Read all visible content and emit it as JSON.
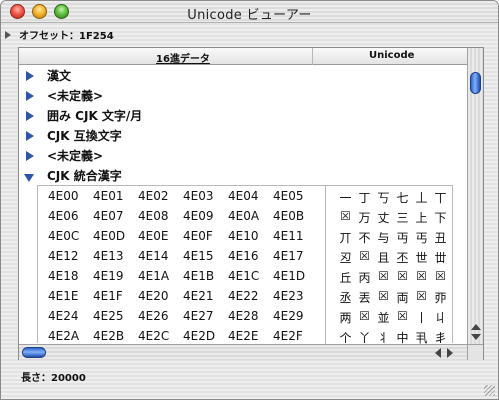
{
  "window": {
    "title": "Unicode ビューアー"
  },
  "offset": {
    "label": "オフセット：1F254"
  },
  "table": {
    "col1": "16進データ",
    "col2": "Unicode"
  },
  "tree": [
    {
      "label": "漢文",
      "open": false
    },
    {
      "label": "<未定義>",
      "open": false
    },
    {
      "label": "囲み CJK 文字/月",
      "open": false
    },
    {
      "label": "CJK 互換文字",
      "open": false
    },
    {
      "label": "<未定義>",
      "open": false
    },
    {
      "label": "CJK 統合漢字",
      "open": true
    }
  ],
  "hex_rows": [
    [
      "4E00",
      "4E01",
      "4E02",
      "4E03",
      "4E04",
      "4E05"
    ],
    [
      "4E06",
      "4E07",
      "4E08",
      "4E09",
      "4E0A",
      "4E0B"
    ],
    [
      "4E0C",
      "4E0D",
      "4E0E",
      "4E0F",
      "4E10",
      "4E11"
    ],
    [
      "4E12",
      "4E13",
      "4E14",
      "4E15",
      "4E16",
      "4E17"
    ],
    [
      "4E18",
      "4E19",
      "4E1A",
      "4E1B",
      "4E1C",
      "4E1D"
    ],
    [
      "4E1E",
      "4E1F",
      "4E20",
      "4E21",
      "4E22",
      "4E23"
    ],
    [
      "4E24",
      "4E25",
      "4E26",
      "4E27",
      "4E28",
      "4E29"
    ],
    [
      "4E2A",
      "4E2B",
      "4E2C",
      "4E2D",
      "4E2E",
      "4E2F"
    ]
  ],
  "glyph_rows": [
    [
      "一",
      "丁",
      "丂",
      "七",
      "丄",
      "丅"
    ],
    [
      "☒",
      "万",
      "丈",
      "三",
      "上",
      "下"
    ],
    [
      "丌",
      "不",
      "与",
      "丏",
      "丐",
      "丑"
    ],
    [
      "丒",
      "☒",
      "且",
      "丕",
      "世",
      "丗"
    ],
    [
      "丘",
      "丙",
      "☒",
      "☒",
      "☒",
      "☒"
    ],
    [
      "丞",
      "丟",
      "☒",
      "両",
      "☒",
      "丣"
    ],
    [
      "两",
      "☒",
      "並",
      "☒",
      "丨",
      "丩"
    ],
    [
      "个",
      "丫",
      "丬",
      "中",
      "丮",
      "丯"
    ]
  ],
  "status": {
    "length": "長さ：20000"
  }
}
